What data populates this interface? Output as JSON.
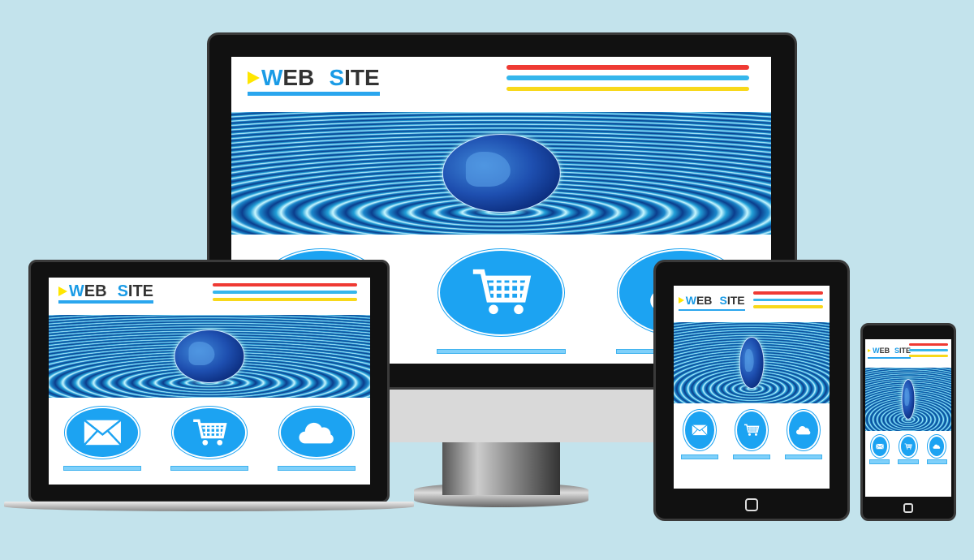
{
  "site": {
    "logo_word1": "WEB",
    "logo_word2": "SITE",
    "logo_w": "W",
    "logo_eb": "EB",
    "logo_s": "S",
    "logo_ite": "ITE",
    "header_line_colors": [
      "#ef3a33",
      "#35b6ec",
      "#f8d81a"
    ],
    "features": [
      {
        "icon": "envelope-icon"
      },
      {
        "icon": "shopping-cart-icon"
      },
      {
        "icon": "cloud-icon"
      }
    ]
  },
  "devices": [
    "desktop-monitor",
    "laptop",
    "tablet",
    "smartphone"
  ],
  "colors": {
    "background": "#c3e3ec",
    "accent": "#1ca3f2",
    "button": "#7fd0fa"
  }
}
